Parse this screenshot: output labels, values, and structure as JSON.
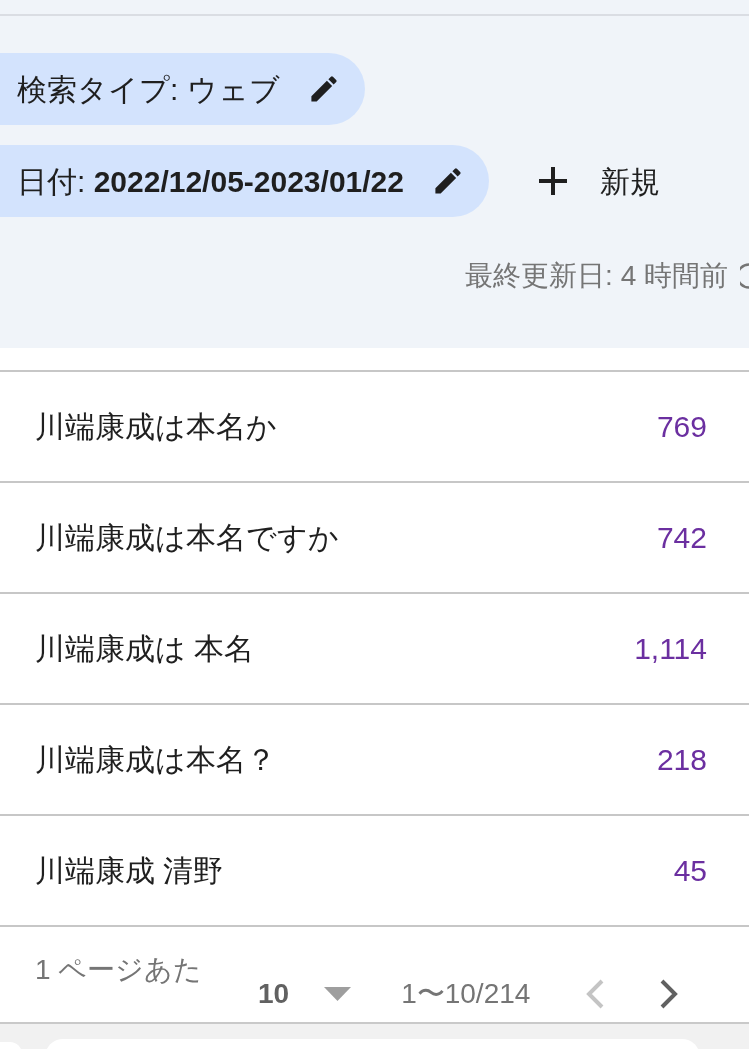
{
  "filters": [
    {
      "label": "検索タイプ: ウェブ"
    },
    {
      "label": "日付: **2022/12/05-2023/01/22**"
    }
  ],
  "new_button": {
    "label": "新規"
  },
  "last_updated": "最終更新日: 4 時間前",
  "rows": [
    {
      "query": "川端康成は本名か",
      "value": "769"
    },
    {
      "query": "川端康成は本名ですか",
      "value": "742"
    },
    {
      "query": "川端康成は 本名",
      "value": "1,114"
    },
    {
      "query": "川端康成は本名？",
      "value": "218"
    },
    {
      "query": "川端康成 清野",
      "value": "45"
    }
  ],
  "pagination": {
    "rows_per_page_label": "1 ページあた",
    "rows_per_page": "10",
    "range": "1〜10/214",
    "prev": {
      "disabled": true
    },
    "next": {
      "disabled": false
    }
  }
}
